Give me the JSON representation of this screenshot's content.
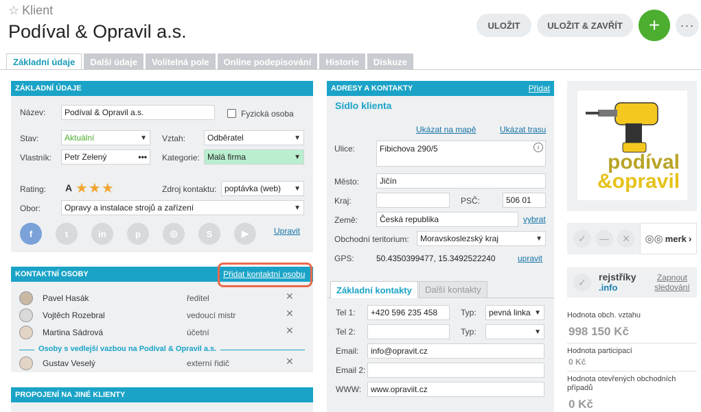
{
  "header": {
    "subtitle": "Klient",
    "title": "Podíval & Opravil a.s.",
    "save": "ULOŽIT",
    "save_close": "ULOŽIT & ZAVŘÍT",
    "add": "+",
    "more": "···"
  },
  "tabs": [
    "Základní údaje",
    "Další údaje",
    "Volitelná pole",
    "Online podepisování",
    "Historie",
    "Diskuze"
  ],
  "basic": {
    "header": "ZÁKLADNÍ ÚDAJE",
    "name_label": "Název:",
    "name_value": "Podíval & Opravil a.s.",
    "person_label": "Fyzická osoba",
    "status_label": "Stav:",
    "status_value": "Aktuální",
    "relation_label": "Vztah:",
    "relation_value": "Odběratel",
    "owner_label": "Vlastník:",
    "owner_value": "Petr Zelený",
    "category_label": "Kategorie:",
    "category_value": "Malá firma",
    "rating_label": "Rating:",
    "rating_value": "A",
    "source_label": "Zdroj kontaktu:",
    "source_value": "poptávka (web)",
    "field_label": "Obor:",
    "field_value": "Opravy a instalace strojů a zařízení",
    "edit": "Upravit",
    "social": [
      "f",
      "t",
      "in",
      "p",
      "◎",
      "S",
      "▶"
    ]
  },
  "contacts": {
    "header": "KONTAKTNÍ OSOBY",
    "add": "Přidat kontaktní osobu",
    "rows": [
      {
        "name": "Pavel Hasák",
        "role": "ředitel"
      },
      {
        "name": "Vojtěch Rozebral",
        "role": "vedoucí mistr"
      },
      {
        "name": "Martina Sádrová",
        "role": "účetní"
      }
    ],
    "secondary_title": "Osoby s vedlejší vazbou na Podíval & Opravil a.s.",
    "secondary": [
      {
        "name": "Gustav Veselý",
        "role": "externí řidič"
      }
    ]
  },
  "links_panel": {
    "header": "PROPOJENÍ NA JINÉ KLIENTY"
  },
  "address": {
    "header": "ADRESY A KONTAKTY",
    "add": "Přidat",
    "title": "Sídlo klienta",
    "show_map": "Ukázat na mapě",
    "show_route": "Ukázat trasu",
    "street_label": "Ulice:",
    "street_value": "Fibichova 290/5",
    "city_label": "Město:",
    "city_value": "Jičín",
    "region_label": "Kraj:",
    "region_value": "",
    "zip_label": "PSČ:",
    "zip_value": "506 01",
    "country_label": "Země:",
    "country_value": "Česká republika",
    "choose": "vybrat",
    "territory_label": "Obchodní teritorium:",
    "territory_value": "Moravskoslezský kraj",
    "gps_label": "GPS:",
    "gps_value": "50.4350399477, 15.3492522240",
    "gps_edit": "upravit"
  },
  "contact_tabs": [
    "Základní kontakty",
    "Další kontakty"
  ],
  "contact_fields": {
    "tel1_label": "Tel 1:",
    "tel1_value": "+420 596 235 458",
    "type_label": "Typ:",
    "type1_value": "pevná linka",
    "tel2_label": "Tel 2:",
    "tel2_value": "",
    "type2_value": "",
    "email_label": "Email:",
    "email_value": "info@opravit.cz",
    "email2_label": "Email 2:",
    "email2_value": "",
    "www_label": "WWW:",
    "www_value": "www.opraviit.cz"
  },
  "logo": {
    "line1": "podíval",
    "line2": "&opravil"
  },
  "merk": {
    "label": "merk",
    "arrow": "›"
  },
  "registry": {
    "line1": "rejstříky",
    "line2": ".info",
    "toggle": "Zapnout sledování"
  },
  "stats": {
    "rel_label": "Hodnota obch. vztahu",
    "rel_value": "998 150 Kč",
    "part_label": "Hodnota participací",
    "part_value": "0 Kč",
    "open_label": "Hodnota otevřených obchodních případů",
    "open_value": "0 Kč"
  },
  "colors": {
    "accent": "#1aa3c7",
    "green": "#4cae2e",
    "highlight": "#e8694a",
    "category_bg": "#b9efcf"
  }
}
